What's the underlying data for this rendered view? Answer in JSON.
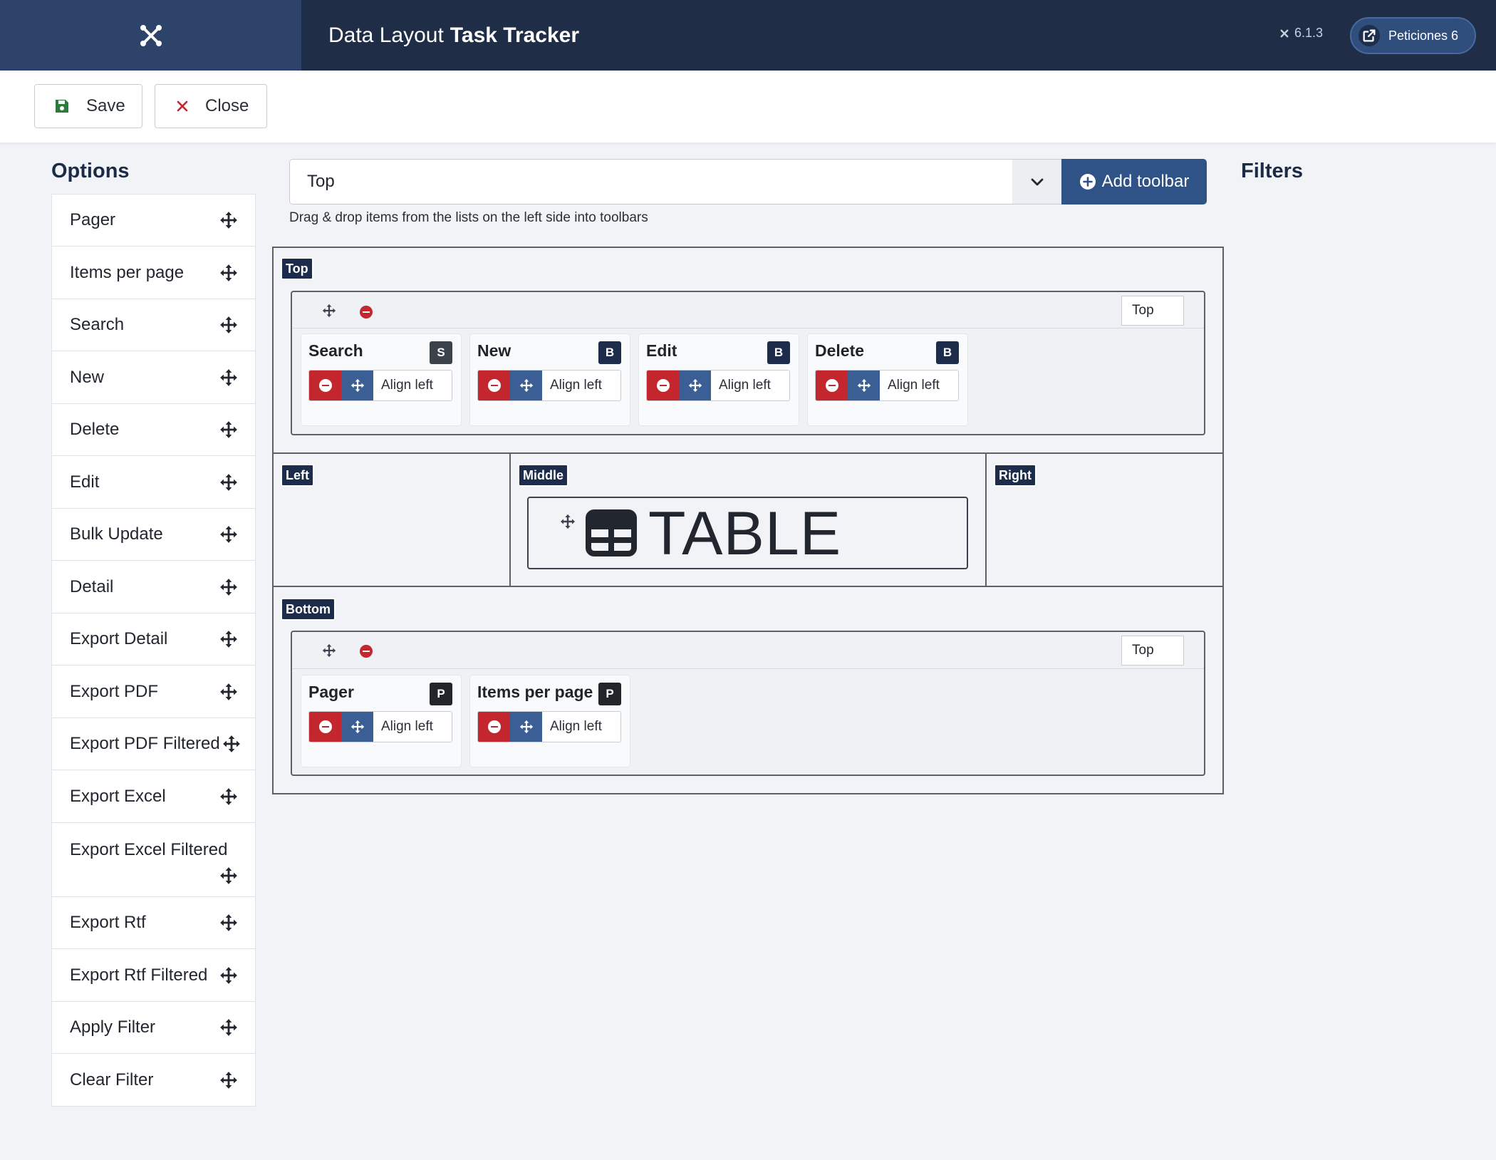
{
  "header": {
    "title_prefix": "Data Layout",
    "title_bold": "Task Tracker",
    "version": "6.1.3",
    "site_button_label": "Peticiones 6"
  },
  "toolbar": {
    "save_label": "Save",
    "close_label": "Close"
  },
  "options": {
    "heading": "Options",
    "items": [
      {
        "label": "Pager"
      },
      {
        "label": "Items per page"
      },
      {
        "label": "Search"
      },
      {
        "label": "New"
      },
      {
        "label": "Delete"
      },
      {
        "label": "Edit"
      },
      {
        "label": "Bulk Update"
      },
      {
        "label": "Detail"
      },
      {
        "label": "Export Detail"
      },
      {
        "label": "Export PDF"
      },
      {
        "label": "Export PDF Filtered"
      },
      {
        "label": "Export Excel"
      },
      {
        "label": "Export Excel Filtered"
      },
      {
        "label": "Export Rtf"
      },
      {
        "label": "Export Rtf Filtered"
      },
      {
        "label": "Apply Filter"
      },
      {
        "label": "Clear Filter"
      }
    ]
  },
  "controls": {
    "position_select_value": "Top",
    "add_toolbar_label": "Add toolbar",
    "hint": "Drag & drop items from the lists on the left side into toolbars"
  },
  "filters": {
    "heading": "Filters"
  },
  "layout": {
    "top": {
      "tag": "Top",
      "toolbar_position": "Top",
      "items": [
        {
          "name": "Search",
          "badge": "S",
          "align": "Align left"
        },
        {
          "name": "New",
          "badge": "B",
          "align": "Align left"
        },
        {
          "name": "Edit",
          "badge": "B",
          "align": "Align left"
        },
        {
          "name": "Delete",
          "badge": "B",
          "align": "Align left"
        }
      ]
    },
    "left": {
      "tag": "Left"
    },
    "middle": {
      "tag": "Middle",
      "table_label": "TABLE"
    },
    "right": {
      "tag": "Right"
    },
    "bottom": {
      "tag": "Bottom",
      "toolbar_position": "Top",
      "items": [
        {
          "name": "Pager",
          "badge": "P",
          "align": "Align left"
        },
        {
          "name": "Items per page",
          "badge": "P",
          "align": "Align left"
        }
      ]
    }
  },
  "colors": {
    "header_bg": "#1f2d47",
    "logo_bg": "#2d4369",
    "primary": "#2f5287",
    "tag_bg": "#1c2c4a",
    "remove_red": "#c3262c",
    "badge_search": "#3c4249",
    "badge_button": "#1c2c4a",
    "badge_pager": "#22262b"
  },
  "icons": {
    "logo": "joomla-icon",
    "save": "floppy-disk-icon",
    "close": "x-icon",
    "move": "arrows-move-icon",
    "remove": "minus-circle-icon",
    "chevron": "chevron-down-icon",
    "add": "plus-circle-icon",
    "external": "external-link-icon",
    "table": "table-icon"
  }
}
